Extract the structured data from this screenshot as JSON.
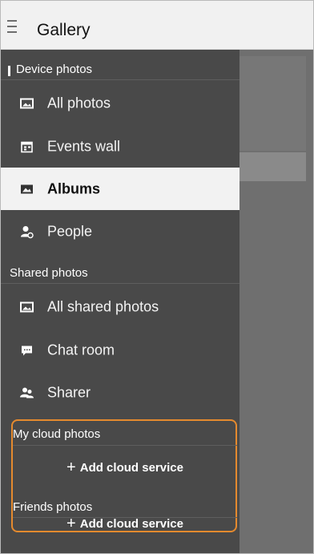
{
  "app": {
    "title": "Gallery"
  },
  "drawer": {
    "device_section": "Device photos",
    "device_items": [
      {
        "label": "All photos",
        "icon": "photo-frame-icon"
      },
      {
        "label": "Events wall",
        "icon": "calendar-icon"
      },
      {
        "label": "Albums",
        "icon": "album-icon",
        "active": true
      },
      {
        "label": "People",
        "icon": "person-icon"
      }
    ],
    "shared_section": "Shared photos",
    "shared_items": [
      {
        "label": "All shared photos",
        "icon": "photo-frame-icon"
      },
      {
        "label": "Chat room",
        "icon": "chat-icon"
      },
      {
        "label": "Sharer",
        "icon": "people-icon"
      }
    ],
    "cloud": {
      "my_cloud": "My cloud photos",
      "my_cloud_add": "Add cloud service",
      "friends": "Friends photos",
      "friends_add": "Add cloud service",
      "highlight_color": "#e58a2e"
    }
  }
}
